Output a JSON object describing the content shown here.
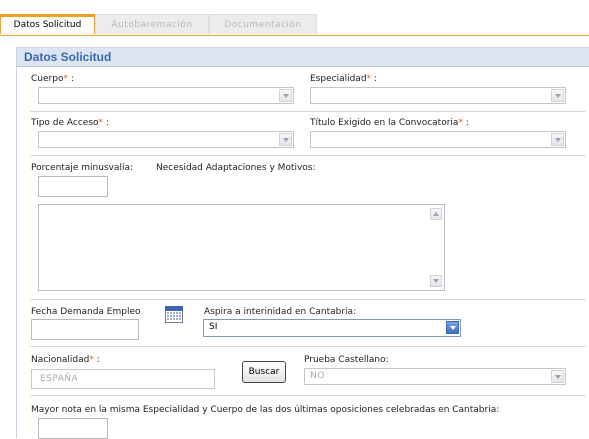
{
  "tabs": [
    {
      "label": "Datos Solicitud"
    },
    {
      "label": "Autobaremación"
    },
    {
      "label": "Documentación"
    }
  ],
  "panel": {
    "title": "Datos Solicitud"
  },
  "fields": {
    "cuerpo": {
      "label": "Cuerpo",
      "req": "*",
      "suffix": " :",
      "value": ""
    },
    "especialidad": {
      "label": "Especialidad",
      "req": "*",
      "suffix": " :",
      "value": ""
    },
    "tipo_acceso": {
      "label": "Tipo de Acceso",
      "req": "*",
      "suffix": " :",
      "value": ""
    },
    "titulo": {
      "label": "Título Exigido en la Convocatoria",
      "req": "*",
      "suffix": " :",
      "value": ""
    },
    "minusvalia": {
      "label": "Porcentaje minusvalía:",
      "value": ""
    },
    "adaptaciones": {
      "label": "Necesidad Adaptaciones y Motivos:",
      "value": ""
    },
    "fecha_demanda": {
      "label": "Fecha Demanda Empleo",
      "value": ""
    },
    "interinidad": {
      "label": "Aspira a interinidad en Cantabria:",
      "value": "SI"
    },
    "nacionalidad": {
      "label": "Nacionalidad",
      "req": "*",
      "suffix": " :",
      "value": "ESPAÑA"
    },
    "buscar": {
      "label": "Buscar"
    },
    "prueba_castellano": {
      "label": "Prueba Castellano:",
      "value": "NO"
    },
    "mayor_nota": {
      "label": "Mayor nota en la misma Especialidad y Cuerpo de las dos últimas oposiciones celebradas en Cantabria:",
      "value": ""
    }
  },
  "icons": {
    "calendar": "calendar-icon"
  },
  "colors": {
    "accent": "#f0a020",
    "panel_title": "#3a66b0",
    "required": "#e05a1a"
  }
}
